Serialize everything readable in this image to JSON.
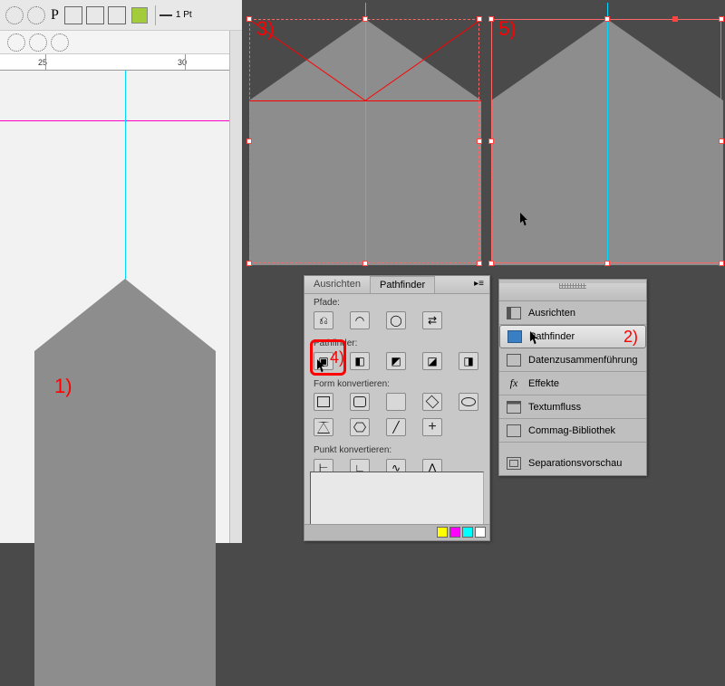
{
  "toolbar": {
    "pt_label": "1 Pt"
  },
  "ruler": {
    "marks": [
      "25",
      "30"
    ]
  },
  "steps": {
    "s1": "1)",
    "s2": "2)",
    "s3": "3)",
    "s4": "4)",
    "s5": "5)"
  },
  "pathfinder": {
    "tab_align": "Ausrichten",
    "tab_pathfinder": "Pathfinder",
    "section_paths": "Pfade:",
    "section_pathfinder": "Pathfinder:",
    "section_convert_shape": "Form konvertieren:",
    "section_convert_point": "Punkt konvertieren:",
    "menu_glyph": "▸≡"
  },
  "flyout": {
    "items": [
      {
        "label": "Ausrichten",
        "icon": "mi-align"
      },
      {
        "label": "Pathfinder",
        "icon": "mi-path",
        "selected": true
      },
      {
        "label": "Datenzusammenführung",
        "icon": "mi-data"
      },
      {
        "label": "Effekte",
        "icon": "mi-fx",
        "icon_text": "fx"
      },
      {
        "label": "Textumfluss",
        "icon": "mi-text"
      },
      {
        "label": "Commag-Bibliothek",
        "icon": "mi-lib"
      },
      {
        "label": "Separationsvorschau",
        "icon": "mi-sep"
      }
    ]
  }
}
